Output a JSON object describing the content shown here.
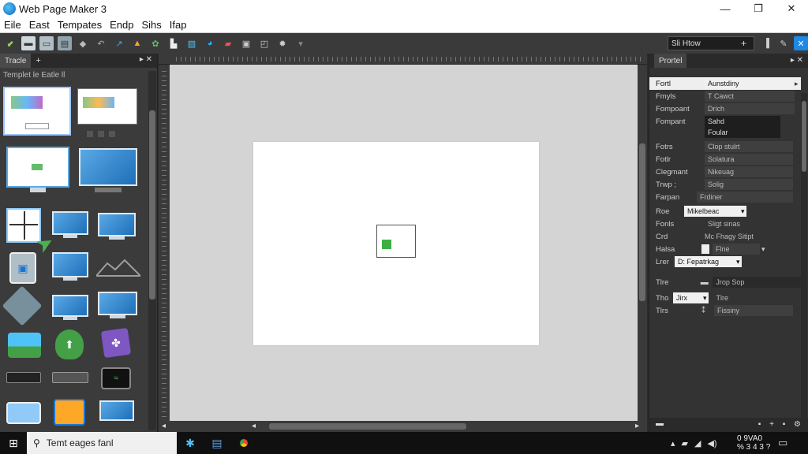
{
  "window": {
    "title": "Web Page Maker 3",
    "min_label": "—",
    "max_label": "❐",
    "close_label": "✕"
  },
  "menu": [
    "Eile",
    "East",
    "Tempates",
    "Endp",
    "Sihs",
    "Ifap"
  ],
  "toolbar": {
    "search_value": "Sli Htow",
    "search_plus": "+"
  },
  "left_panel": {
    "tab_label": "Tracle",
    "tab_add": "+",
    "tab_ctrl": "▸ ✕",
    "heading": "Templet le Eatle ll"
  },
  "right_panel": {
    "tab_label": "Prortel",
    "tab_ctrl": "▸ ✕",
    "rows": [
      {
        "label": "Fortl",
        "value": "Aunstdiny"
      },
      {
        "label": "Fmyls",
        "value": "T Cawct"
      },
      {
        "label": "Fompoant",
        "value": "Drich"
      },
      {
        "label": "Fompant",
        "value": "Sahd"
      },
      {
        "label": "",
        "value": "Foular"
      },
      {
        "label": "Fotrs",
        "value": "Clop stulrt"
      },
      {
        "label": "Fotlr",
        "value": "Solatura"
      },
      {
        "label": "Clegmant",
        "value": "Nikeuag"
      },
      {
        "label": "Trwp ;",
        "value": "Solig"
      },
      {
        "label": "Farpan",
        "value": "Frdiner"
      },
      {
        "label": "Roe",
        "value": "Mikelbeac"
      },
      {
        "label": "Fonls",
        "value": "Sligt sinas"
      },
      {
        "label": "Crd",
        "value": "Mc Fhagy Sitipt"
      },
      {
        "label": "Halsa",
        "value": "Flne"
      },
      {
        "label": "Lrer",
        "value": "D: Fepatrkag"
      },
      {
        "label": "Tlre",
        "value": "Jrop Sop"
      },
      {
        "label": "Tho",
        "value": "Jirx"
      },
      {
        "label": "",
        "value": "Tlre"
      },
      {
        "label": "Tlrs",
        "value": "Fissiny"
      }
    ]
  },
  "taskbar": {
    "search_text": "Temt eages fanl",
    "clock_time": "0 9VA0",
    "clock_date": "% 3 4 3 ?"
  }
}
